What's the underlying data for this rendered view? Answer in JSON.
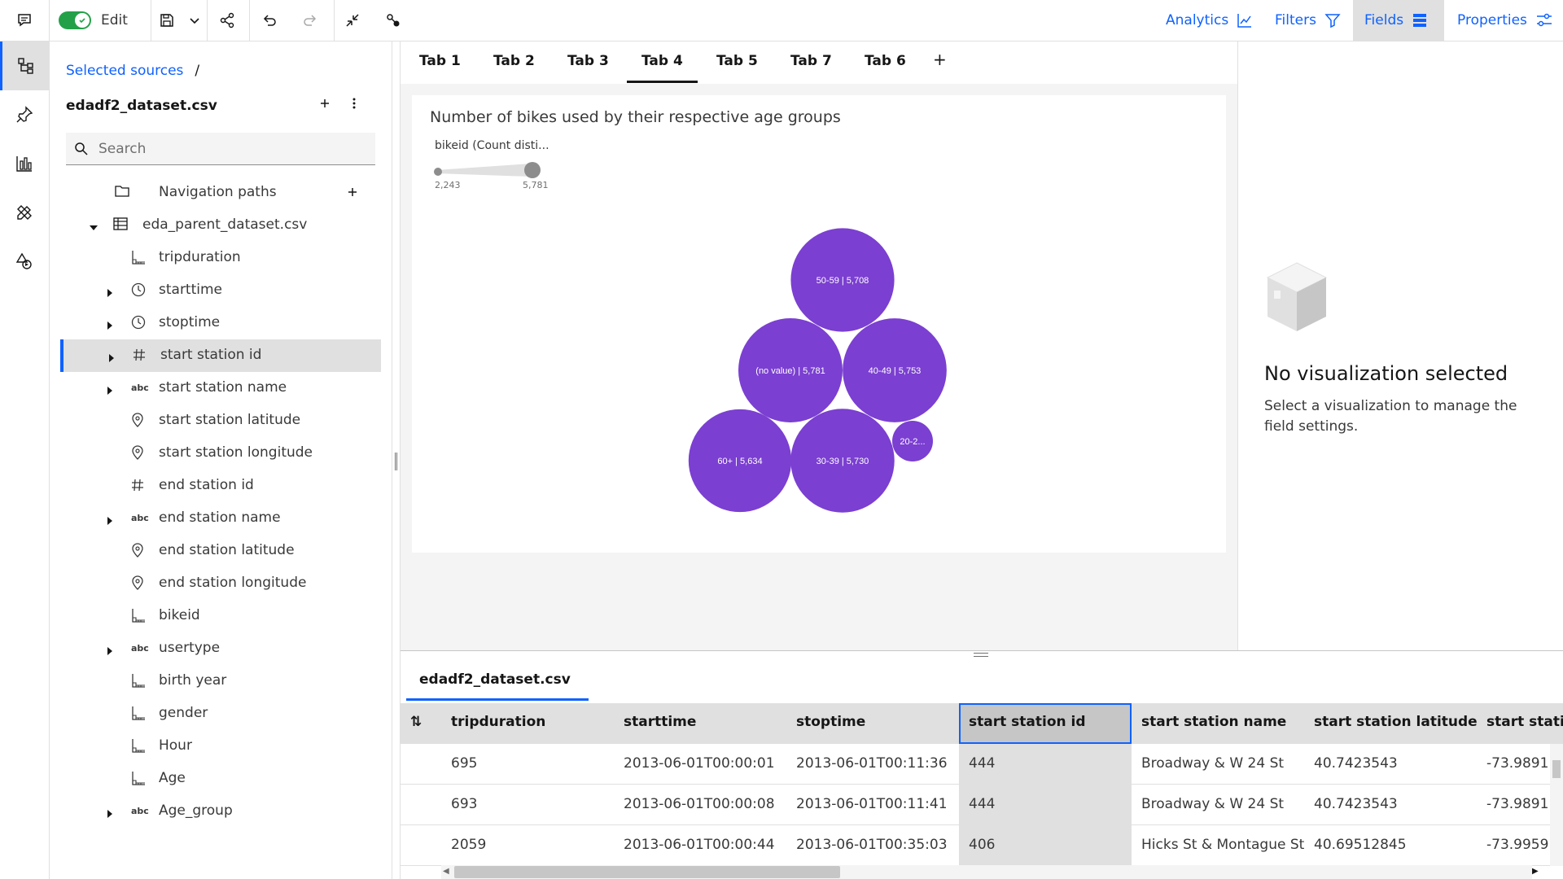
{
  "toolbar": {
    "edit_label": "Edit",
    "right_tabs": [
      {
        "label": "Analytics",
        "icon": "analytics-icon"
      },
      {
        "label": "Filters",
        "icon": "filter-icon"
      },
      {
        "label": "Fields",
        "icon": "fields-icon",
        "active": true
      },
      {
        "label": "Properties",
        "icon": "properties-icon"
      }
    ]
  },
  "sources": {
    "breadcrumb_link": "Selected sources",
    "breadcrumb_sep": "/",
    "dataset_title": "edadf2_dataset.csv",
    "search_placeholder": "Search",
    "items": [
      {
        "label": "Navigation paths",
        "icon": "folder-icon"
      },
      {
        "label": "eda_parent_dataset.csv",
        "icon": "table-icon"
      },
      {
        "label": "tripduration",
        "icon": "measure-icon"
      },
      {
        "label": "starttime",
        "icon": "clock-icon"
      },
      {
        "label": "stoptime",
        "icon": "clock-icon"
      },
      {
        "label": "start station id",
        "icon": "hash-icon"
      },
      {
        "label": "start station name",
        "icon": "abc-icon"
      },
      {
        "label": "start station latitude",
        "icon": "location-icon"
      },
      {
        "label": "start station longitude",
        "icon": "location-icon"
      },
      {
        "label": "end station id",
        "icon": "hash-icon"
      },
      {
        "label": "end station name",
        "icon": "abc-icon"
      },
      {
        "label": "end station latitude",
        "icon": "location-icon"
      },
      {
        "label": "end station longitude",
        "icon": "location-icon"
      },
      {
        "label": "bikeid",
        "icon": "measure-icon"
      },
      {
        "label": "usertype",
        "icon": "abc-icon"
      },
      {
        "label": "birth year",
        "icon": "measure-icon"
      },
      {
        "label": "gender",
        "icon": "measure-icon"
      },
      {
        "label": "Hour",
        "icon": "measure-icon"
      },
      {
        "label": "Age",
        "icon": "measure-icon"
      },
      {
        "label": "Age_group",
        "icon": "abc-icon"
      }
    ],
    "abc_glyph": "abc"
  },
  "tabs": [
    "Tab 1",
    "Tab 2",
    "Tab 3",
    "Tab 4",
    "Tab 5",
    "Tab 7",
    "Tab 6"
  ],
  "active_tab": "Tab 4",
  "add_tab": "+",
  "viz": {
    "title": "Number of bikes used by their respective age groups",
    "slider_label": "bikeid (Count disti...",
    "slider_min": "2,243",
    "slider_max": "5,781",
    "bubble_color": "#7b3fd1"
  },
  "chart_data": {
    "type": "bubble",
    "title": "Number of bikes used by their respective age groups",
    "size_measure": "bikeid (Count disti...",
    "size_range": [
      2243,
      5781
    ],
    "bubbles": [
      {
        "label": "50-59 | 5,708",
        "category": "50-59",
        "value": 5708
      },
      {
        "label": "(no value) | 5,781",
        "category": "(no value)",
        "value": 5781
      },
      {
        "label": "40-49 | 5,753",
        "category": "40-49",
        "value": 5753
      },
      {
        "label": "60+ | 5,634",
        "category": "60+",
        "value": 5634
      },
      {
        "label": "30-39 | 5,730",
        "category": "30-39",
        "value": 5730
      },
      {
        "label": "20-2...",
        "category": "20-2...",
        "value": 2243
      }
    ]
  },
  "properties": {
    "empty_title": "No visualization selected",
    "empty_text": "Select a visualization to manage the field settings."
  },
  "preview": {
    "tab_label": "edadf2_dataset.csv",
    "columns": [
      "tripduration",
      "starttime",
      "stoptime",
      "start station id",
      "start station name",
      "start station latitude",
      "start statio"
    ],
    "rows": [
      [
        "695",
        "2013-06-01T00:00:01",
        "2013-06-01T00:11:36",
        "444",
        "Broadway & W 24 St",
        "40.7423543",
        "-73.9891"
      ],
      [
        "693",
        "2013-06-01T00:00:08",
        "2013-06-01T00:11:41",
        "444",
        "Broadway & W 24 St",
        "40.7423543",
        "-73.9891"
      ],
      [
        "2059",
        "2013-06-01T00:00:44",
        "2013-06-01T00:35:03",
        "406",
        "Hicks St & Montague St",
        "40.69512845",
        "-73.9959"
      ]
    ]
  }
}
